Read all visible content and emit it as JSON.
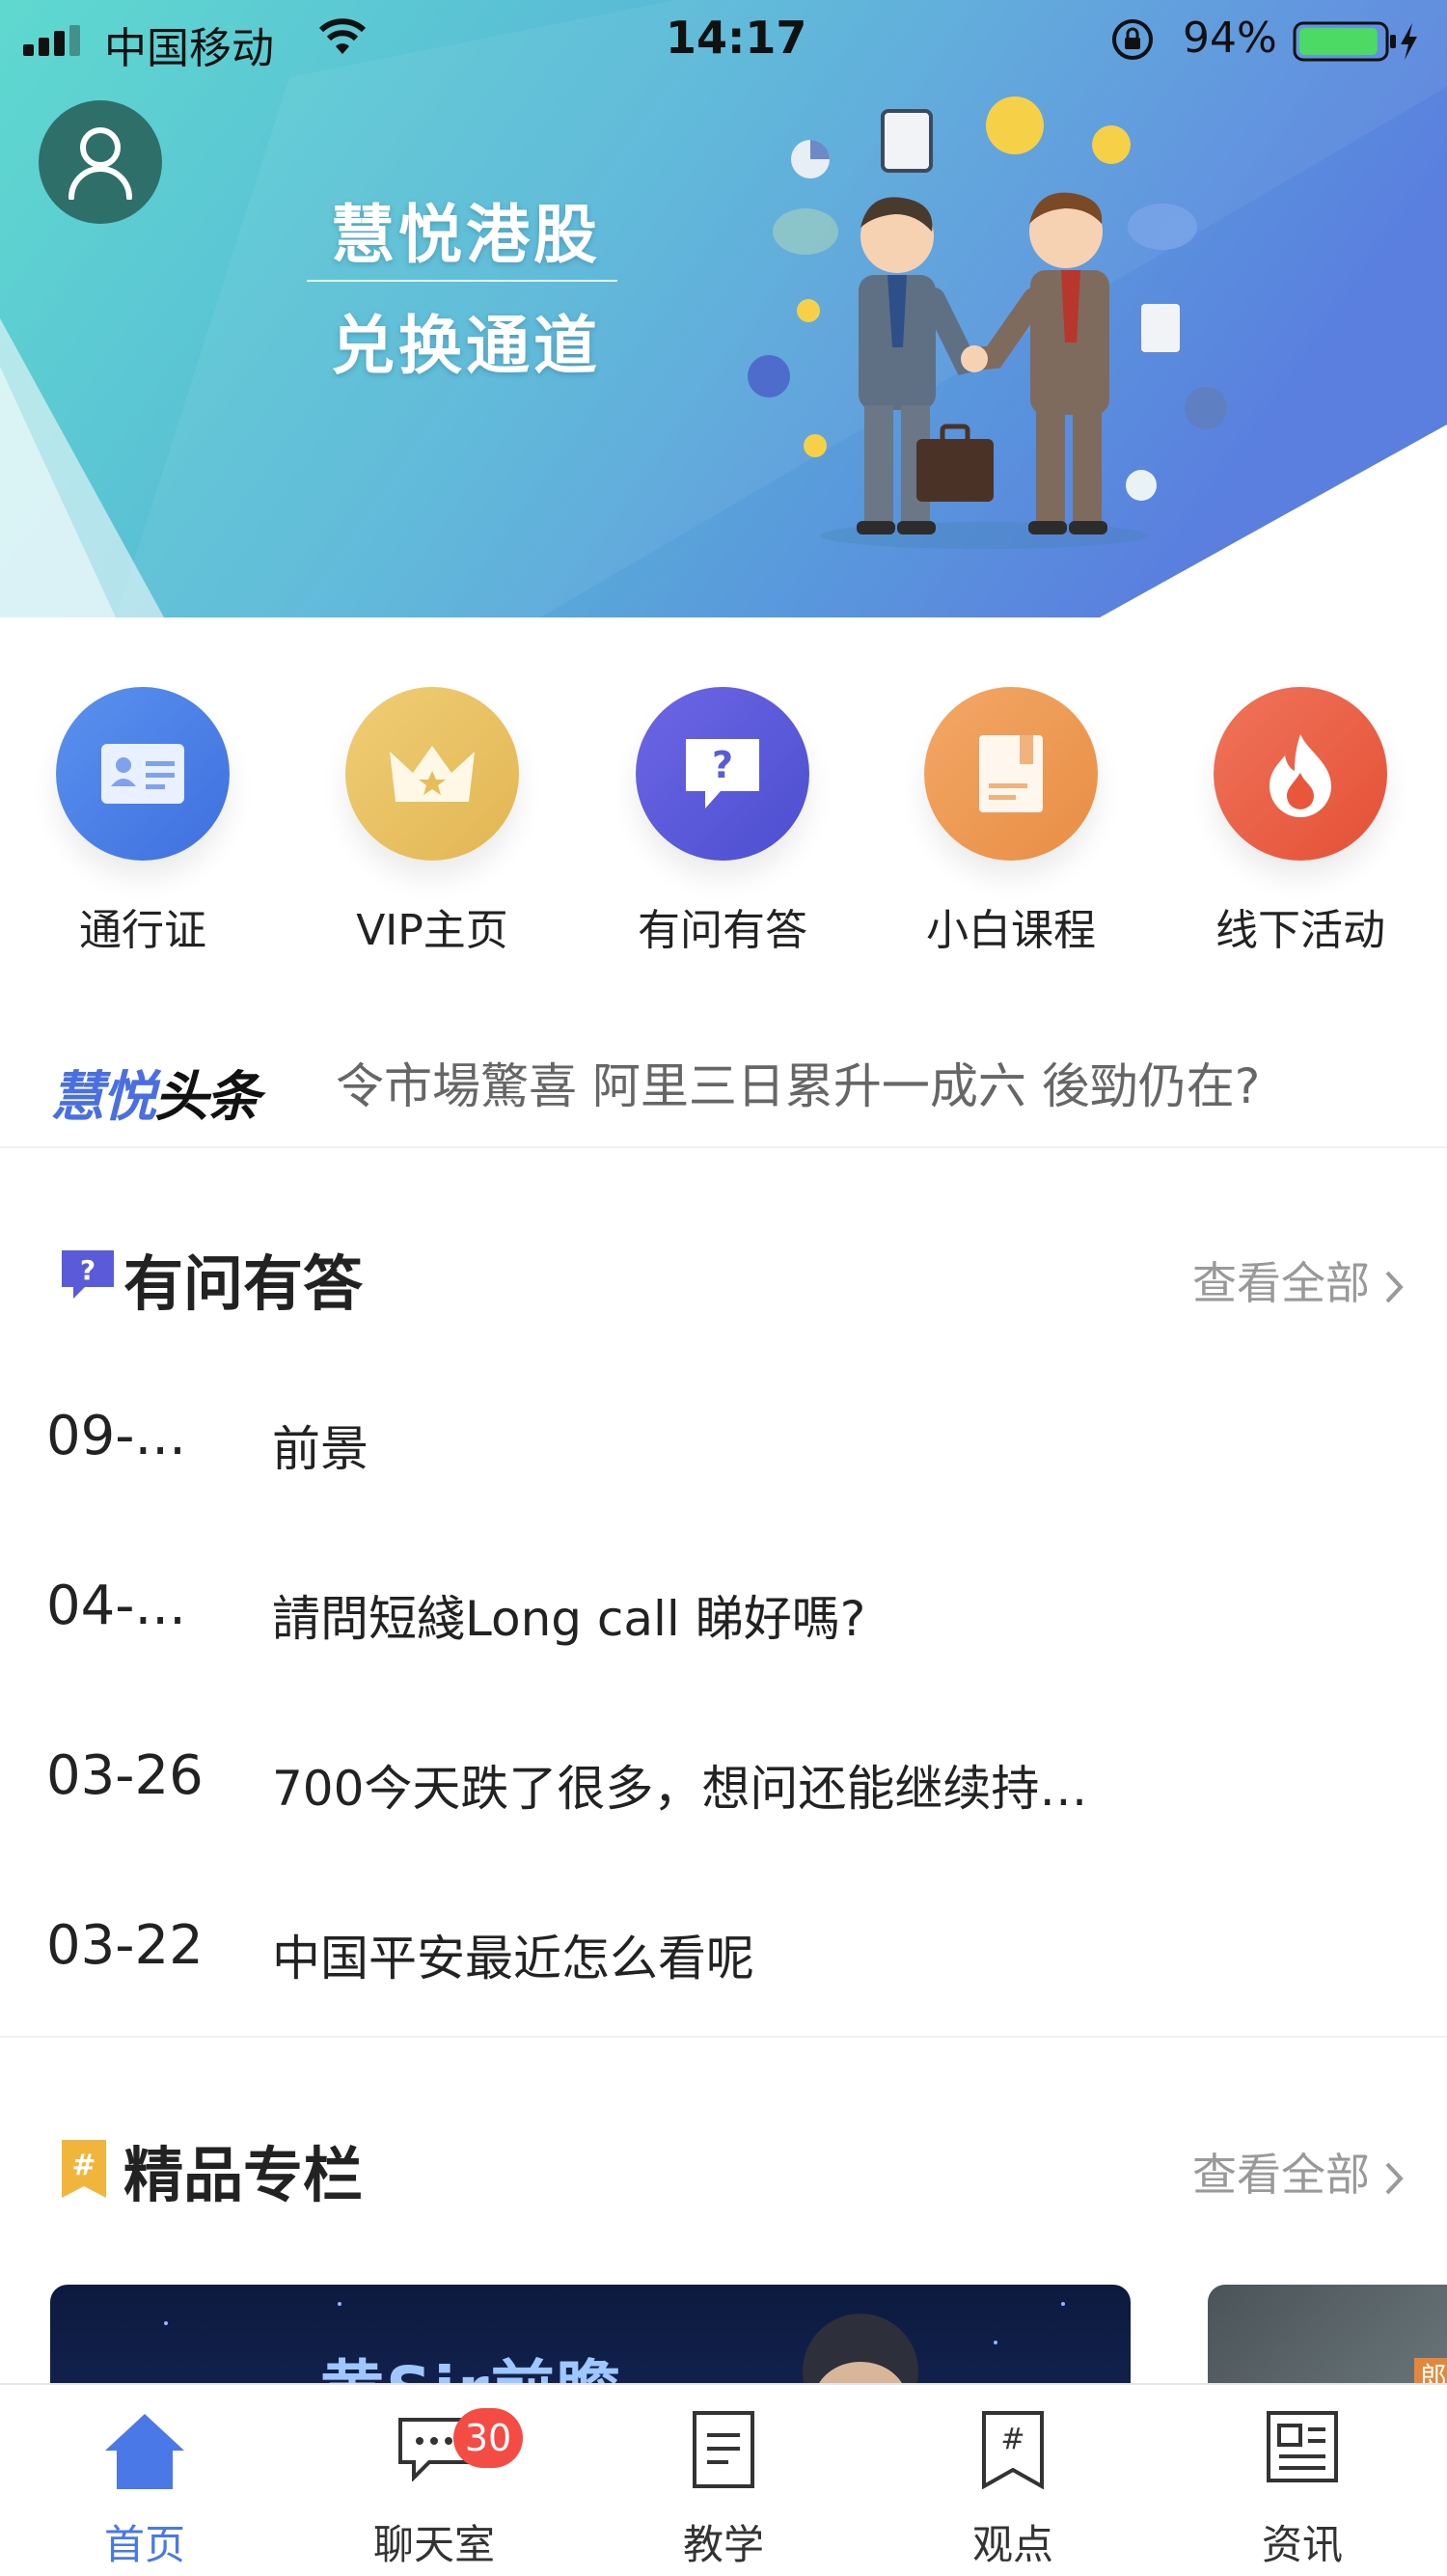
{
  "status_bar": {
    "carrier": "中国移动",
    "time": "14:17",
    "battery_percent": "94%",
    "battery_level": 0.94
  },
  "banner": {
    "title_line_1": "慧悦港股",
    "title_line_2": "兑换通道"
  },
  "quick_actions": [
    {
      "label": "通行证",
      "icon": "pass-card-icon",
      "color": "#4a7fe8"
    },
    {
      "label": "VIP主页",
      "icon": "crown-icon",
      "color": "#e8c064"
    },
    {
      "label": "有问有答",
      "icon": "question-bubble-icon",
      "color": "#5a5bd8"
    },
    {
      "label": "小白课程",
      "icon": "book-icon",
      "color": "#ee9b55"
    },
    {
      "label": "线下活动",
      "icon": "flame-icon",
      "color": "#ea6248"
    }
  ],
  "headlines": {
    "logo_part_1": "慧悦",
    "logo_part_2": "头条",
    "text": "令市場驚喜 阿里三日累升一成六 後勁仍在?"
  },
  "qa_section": {
    "title": "有问有答",
    "more_label": "查看全部",
    "items": [
      {
        "date": "09-...",
        "question": "前景"
      },
      {
        "date": "04-...",
        "question": "請問短綫Long call 睇好嗎?"
      },
      {
        "date": "03-26",
        "question": "700今天跌了很多，想问还能继续持…"
      },
      {
        "date": "03-22",
        "question": "中国平安最近怎么看呢"
      }
    ]
  },
  "featured_section": {
    "title": "精品专栏",
    "more_label": "查看全部",
    "card_1_title": "黄Sir前瞻",
    "card_2_tag": "郎"
  },
  "tab_bar": {
    "tabs": [
      {
        "label": "首页",
        "icon": "home-icon",
        "active": true
      },
      {
        "label": "聊天室",
        "icon": "chat-icon",
        "active": false
      },
      {
        "label": "教学",
        "icon": "document-icon",
        "active": false
      },
      {
        "label": "观点",
        "icon": "bookmark-hash-icon",
        "active": false
      },
      {
        "label": "资讯",
        "icon": "news-icon",
        "active": false
      }
    ],
    "chat_badge": "30"
  },
  "colors": {
    "accent": "#4a78e6",
    "badge": "#f44b45",
    "banner_start": "#5fd6cf",
    "banner_end": "#5a86e0"
  }
}
